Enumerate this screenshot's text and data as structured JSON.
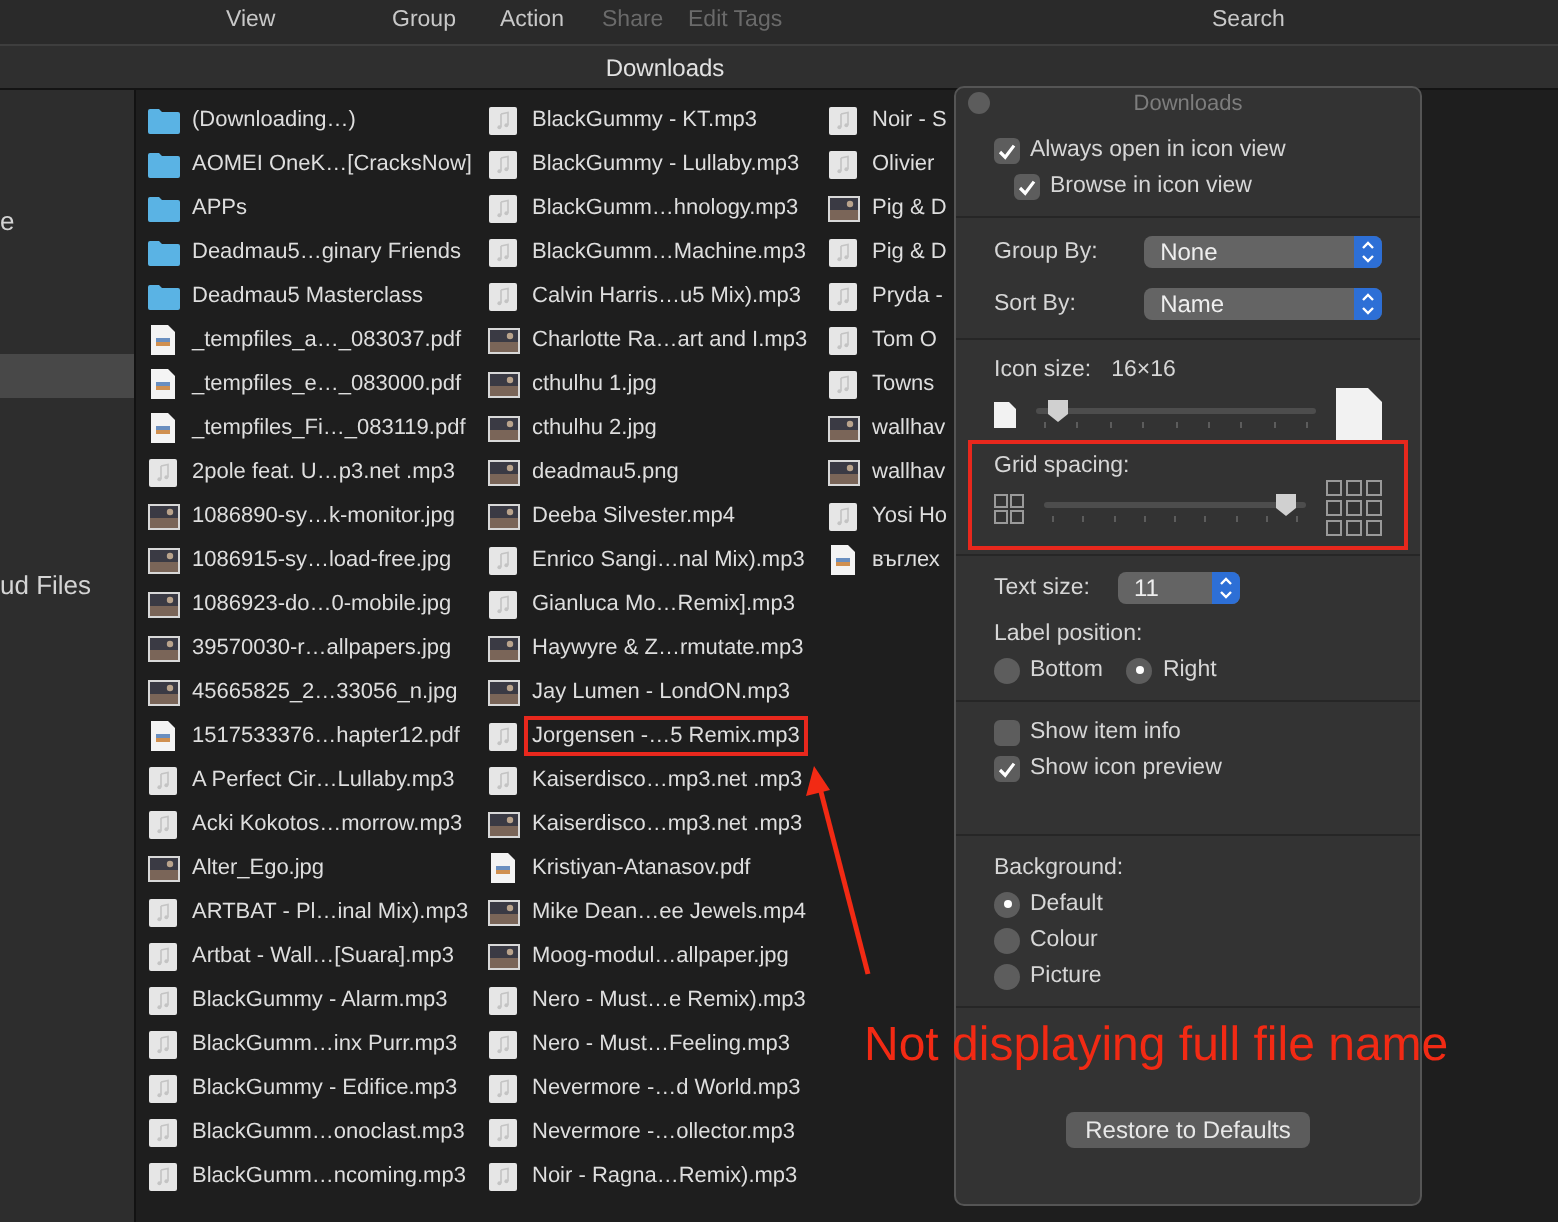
{
  "toolbar": {
    "items": [
      {
        "label": "View",
        "disabled": false
      },
      {
        "label": "Group",
        "disabled": false
      },
      {
        "label": "Action",
        "disabled": false
      },
      {
        "label": "Share",
        "disabled": true
      },
      {
        "label": "Edit Tags",
        "disabled": true
      }
    ],
    "search": "Search"
  },
  "window": {
    "title": "Downloads"
  },
  "sidebar": {
    "items": [
      {
        "label": "e",
        "selected": false
      },
      {
        "selected": true
      },
      {
        "label": "ud Files",
        "selected": false
      }
    ]
  },
  "files": {
    "columns": [
      [
        {
          "name": "(Downloading…)",
          "kind": "folder",
          "highlighted": false
        },
        {
          "name": "AOMEI OneK…[CracksNow]",
          "kind": "folder",
          "highlighted": false
        },
        {
          "name": "APPs",
          "kind": "folder",
          "highlighted": false
        },
        {
          "name": "Deadmau5…ginary Friends",
          "kind": "folder",
          "highlighted": false
        },
        {
          "name": "Deadmau5 Masterclass",
          "kind": "folder",
          "highlighted": false
        },
        {
          "name": "_tempfiles_a…_083037.pdf",
          "kind": "document",
          "highlighted": false
        },
        {
          "name": "_tempfiles_e…_083000.pdf",
          "kind": "document",
          "highlighted": false
        },
        {
          "name": "_tempfiles_Fi…_083119.pdf",
          "kind": "document",
          "highlighted": false
        },
        {
          "name": "2pole feat. U…p3.net .mp3",
          "kind": "audio",
          "highlighted": false
        },
        {
          "name": "1086890-sy…k-monitor.jpg",
          "kind": "image",
          "highlighted": false
        },
        {
          "name": "1086915-sy…load-free.jpg",
          "kind": "image",
          "highlighted": false
        },
        {
          "name": "1086923-do…0-mobile.jpg",
          "kind": "image",
          "highlighted": false
        },
        {
          "name": "39570030-r…allpapers.jpg",
          "kind": "image",
          "highlighted": false
        },
        {
          "name": "45665825_2…33056_n.jpg",
          "kind": "image",
          "highlighted": false
        },
        {
          "name": "1517533376…hapter12.pdf",
          "kind": "document",
          "highlighted": false
        },
        {
          "name": "A Perfect Cir…Lullaby.mp3",
          "kind": "audio",
          "highlighted": false
        },
        {
          "name": "Acki Kokotos…morrow.mp3",
          "kind": "audio",
          "highlighted": false
        },
        {
          "name": "Alter_Ego.jpg",
          "kind": "image",
          "highlighted": false
        },
        {
          "name": "ARTBAT - Pl…inal Mix).mp3",
          "kind": "audio",
          "highlighted": false
        },
        {
          "name": "Artbat - Wall…[Suara].mp3",
          "kind": "audio",
          "highlighted": false
        },
        {
          "name": "BlackGummy - Alarm.mp3",
          "kind": "audio",
          "highlighted": false
        },
        {
          "name": "BlackGumm…inx Purr.mp3",
          "kind": "audio",
          "highlighted": false
        },
        {
          "name": "BlackGummy - Edifice.mp3",
          "kind": "audio",
          "highlighted": false
        },
        {
          "name": "BlackGumm…onoclast.mp3",
          "kind": "audio",
          "highlighted": false
        },
        {
          "name": "BlackGumm…ncoming.mp3",
          "kind": "audio",
          "highlighted": false
        }
      ],
      [
        {
          "name": "BlackGummy - KT.mp3",
          "kind": "audio",
          "highlighted": false
        },
        {
          "name": "BlackGummy - Lullaby.mp3",
          "kind": "audio",
          "highlighted": false
        },
        {
          "name": "BlackGumm…hnology.mp3",
          "kind": "audio",
          "highlighted": false
        },
        {
          "name": "BlackGumm…Machine.mp3",
          "kind": "audio",
          "highlighted": false
        },
        {
          "name": "Calvin Harris…u5 Mix).mp3",
          "kind": "audio",
          "highlighted": false
        },
        {
          "name": "Charlotte Ra…art and I.mp3",
          "kind": "image",
          "highlighted": false
        },
        {
          "name": "cthulhu 1.jpg",
          "kind": "image",
          "highlighted": false
        },
        {
          "name": "cthulhu 2.jpg",
          "kind": "image",
          "highlighted": false
        },
        {
          "name": "deadmau5.png",
          "kind": "image",
          "highlighted": false
        },
        {
          "name": "Deeba Silvester.mp4",
          "kind": "image",
          "highlighted": false
        },
        {
          "name": "Enrico Sangi…nal Mix).mp3",
          "kind": "audio",
          "highlighted": false
        },
        {
          "name": "Gianluca Mo…Remix].mp3",
          "kind": "audio",
          "highlighted": false
        },
        {
          "name": "Haywyre & Z…rmutate.mp3",
          "kind": "image",
          "highlighted": false
        },
        {
          "name": "Jay Lumen - LondON.mp3",
          "kind": "image",
          "highlighted": false
        },
        {
          "name": "Jorgensen -…5 Remix.mp3",
          "kind": "audio",
          "highlighted": true
        },
        {
          "name": "Kaiserdisco…mp3.net .mp3",
          "kind": "audio",
          "highlighted": false
        },
        {
          "name": "Kaiserdisco…mp3.net .mp3",
          "kind": "image",
          "highlighted": false
        },
        {
          "name": "Kristiyan-Atanasov.pdf",
          "kind": "document",
          "highlighted": false
        },
        {
          "name": "Mike Dean…ee Jewels.mp4",
          "kind": "image",
          "highlighted": false
        },
        {
          "name": "Moog-modul…allpaper.jpg",
          "kind": "image",
          "highlighted": false
        },
        {
          "name": "Nero - Must…e Remix).mp3",
          "kind": "audio",
          "highlighted": false
        },
        {
          "name": "Nero - Must…Feeling.mp3",
          "kind": "audio",
          "highlighted": false
        },
        {
          "name": "Nevermore -…d World.mp3",
          "kind": "audio",
          "highlighted": false
        },
        {
          "name": "Nevermore -…ollector.mp3",
          "kind": "audio",
          "highlighted": false
        },
        {
          "name": "Noir - Ragna…Remix).mp3",
          "kind": "audio",
          "highlighted": false
        }
      ],
      [
        {
          "name": "Noir - S",
          "kind": "audio",
          "highlighted": false
        },
        {
          "name": "Olivier",
          "kind": "audio",
          "highlighted": false
        },
        {
          "name": "Pig & D",
          "kind": "image",
          "highlighted": false
        },
        {
          "name": "Pig & D",
          "kind": "audio",
          "highlighted": false
        },
        {
          "name": "Pryda -",
          "kind": "audio",
          "highlighted": false
        },
        {
          "name": "Tom O",
          "kind": "audio",
          "highlighted": false
        },
        {
          "name": "Towns",
          "kind": "audio",
          "highlighted": false
        },
        {
          "name": "wallhav",
          "kind": "image",
          "highlighted": false
        },
        {
          "name": "wallhav",
          "kind": "image",
          "highlighted": false
        },
        {
          "name": "Yosi Ho",
          "kind": "audio",
          "highlighted": false
        },
        {
          "name": "въглех",
          "kind": "document",
          "highlighted": false
        }
      ]
    ]
  },
  "inspector": {
    "title": "Downloads",
    "view_options": [
      {
        "label": "Always open in icon view",
        "checked": true,
        "children": [
          {
            "label": "Browse in icon view",
            "checked": true
          }
        ]
      }
    ],
    "group_by": {
      "label": "Group By:",
      "value": "None"
    },
    "sort_by": {
      "label": "Sort By:",
      "value": "Name"
    },
    "icon_size": {
      "label": "Icon size:",
      "value": "16×16",
      "level": 0.04
    },
    "grid_spacing": {
      "label": "Grid spacing:",
      "level": 0.97,
      "highlighted": true
    },
    "text_size": {
      "label": "Text size:",
      "value": "11"
    },
    "label_position": {
      "label": "Label position:",
      "options": [
        {
          "label": "Bottom",
          "selected": false
        },
        {
          "label": "Right",
          "selected": true
        }
      ]
    },
    "show_options": [
      {
        "label": "Show item info",
        "checked": false
      },
      {
        "label": "Show icon preview",
        "checked": true
      }
    ],
    "background": {
      "label": "Background:",
      "options": [
        {
          "label": "Default",
          "selected": true
        },
        {
          "label": "Colour",
          "selected": false
        },
        {
          "label": "Picture",
          "selected": false
        }
      ]
    },
    "restore_button": "Restore to Defaults"
  },
  "annotation": {
    "text": "Not displaying full file name"
  }
}
